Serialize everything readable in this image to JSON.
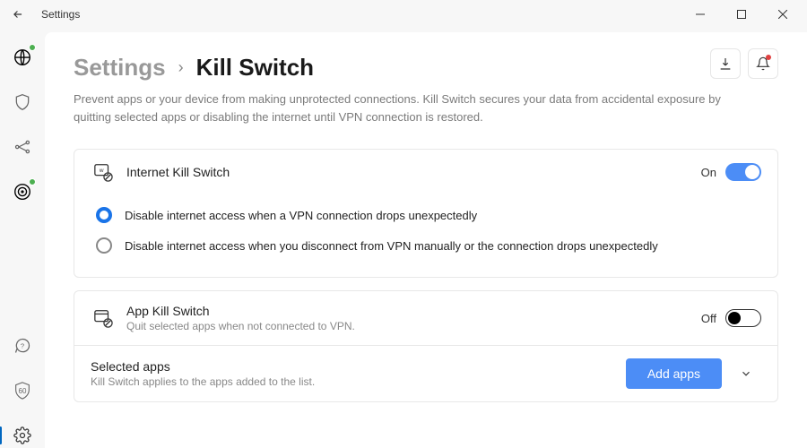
{
  "titlebar": {
    "title": "Settings"
  },
  "breadcrumb": {
    "root": "Settings",
    "sep": "›",
    "leaf": "Kill Switch"
  },
  "description": "Prevent apps or your device from making unprotected connections. Kill Switch secures your data from accidental exposure by quitting selected apps or disabling the internet until VPN connection is restored.",
  "internet_ks": {
    "title": "Internet Kill Switch",
    "state_label": "On",
    "on": true,
    "options": [
      {
        "label": "Disable internet access when a VPN connection drops unexpectedly",
        "selected": true
      },
      {
        "label": "Disable internet access when you disconnect from VPN manually or the connection drops unexpectedly",
        "selected": false
      }
    ]
  },
  "app_ks": {
    "title": "App Kill Switch",
    "subtitle": "Quit selected apps when not connected to VPN.",
    "state_label": "Off",
    "on": false
  },
  "selected_apps": {
    "title": "Selected apps",
    "subtitle": "Kill Switch applies to the apps added to the list.",
    "button": "Add apps"
  },
  "sidebar": {
    "badge_text": "60"
  }
}
